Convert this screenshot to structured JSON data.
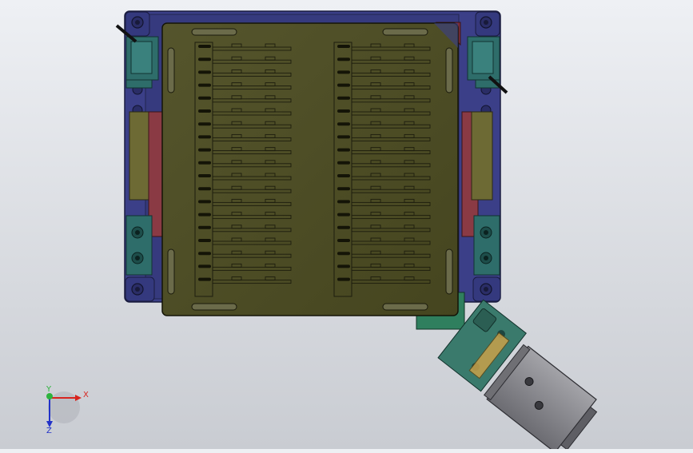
{
  "viewport": {
    "background_top": "#eef0f4",
    "background_bottom": "#c9ccd2"
  },
  "model": {
    "frame_color": "#3b3f88",
    "tray_color": "#4b4b26",
    "slot_row_count": 19,
    "slot_column_count": 2,
    "clamp_color": "#2e6d6a",
    "rail_color": "#8a3a44",
    "cylinder_color": "#8e8e92",
    "gripper_color": "#3a7a6c"
  },
  "triad": {
    "x_label": "X",
    "y_label": "Y",
    "z_label": "Z",
    "x_color": "#d8251f",
    "y_color": "#2db33d",
    "z_color": "#2232c8"
  }
}
